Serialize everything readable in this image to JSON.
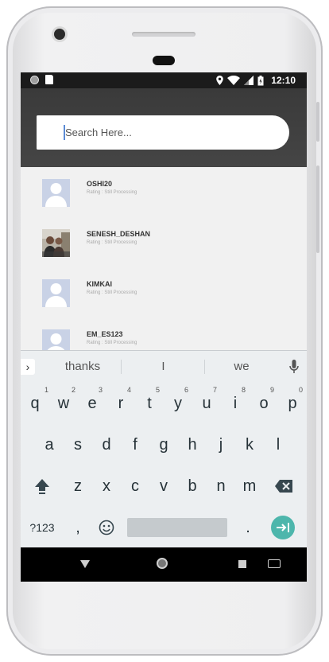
{
  "statusbar": {
    "time": "12:10"
  },
  "search": {
    "placeholder": "Search Here..."
  },
  "users": [
    {
      "name": "OSHI20",
      "rating": "Rating : Still Processing",
      "avatar": "default-avatar"
    },
    {
      "name": "SENESH_DESHAN",
      "rating": "Rating : Still Processing",
      "avatar": "photo-avatar"
    },
    {
      "name": "KIMKAI",
      "rating": "Rating : Still Processing",
      "avatar": "default-avatar"
    },
    {
      "name": "EM_ES123",
      "rating": "Rating : Still Processing",
      "avatar": "default-avatar"
    }
  ],
  "keyboard": {
    "suggestions": [
      "thanks",
      "I",
      "we"
    ],
    "row1": [
      "q",
      "w",
      "e",
      "r",
      "t",
      "y",
      "u",
      "i",
      "o",
      "p"
    ],
    "row1_hints": [
      "1",
      "2",
      "3",
      "4",
      "5",
      "6",
      "7",
      "8",
      "9",
      "0"
    ],
    "row2": [
      "a",
      "s",
      "d",
      "f",
      "g",
      "h",
      "j",
      "k",
      "l"
    ],
    "row3": [
      "z",
      "x",
      "c",
      "v",
      "b",
      "n",
      "m"
    ],
    "symbols_label": "?123",
    "comma": ",",
    "period": "."
  },
  "colors": {
    "header_bg": "#404040",
    "enter_key": "#4db6ac",
    "avatar_bg": "#c9d2e6"
  }
}
